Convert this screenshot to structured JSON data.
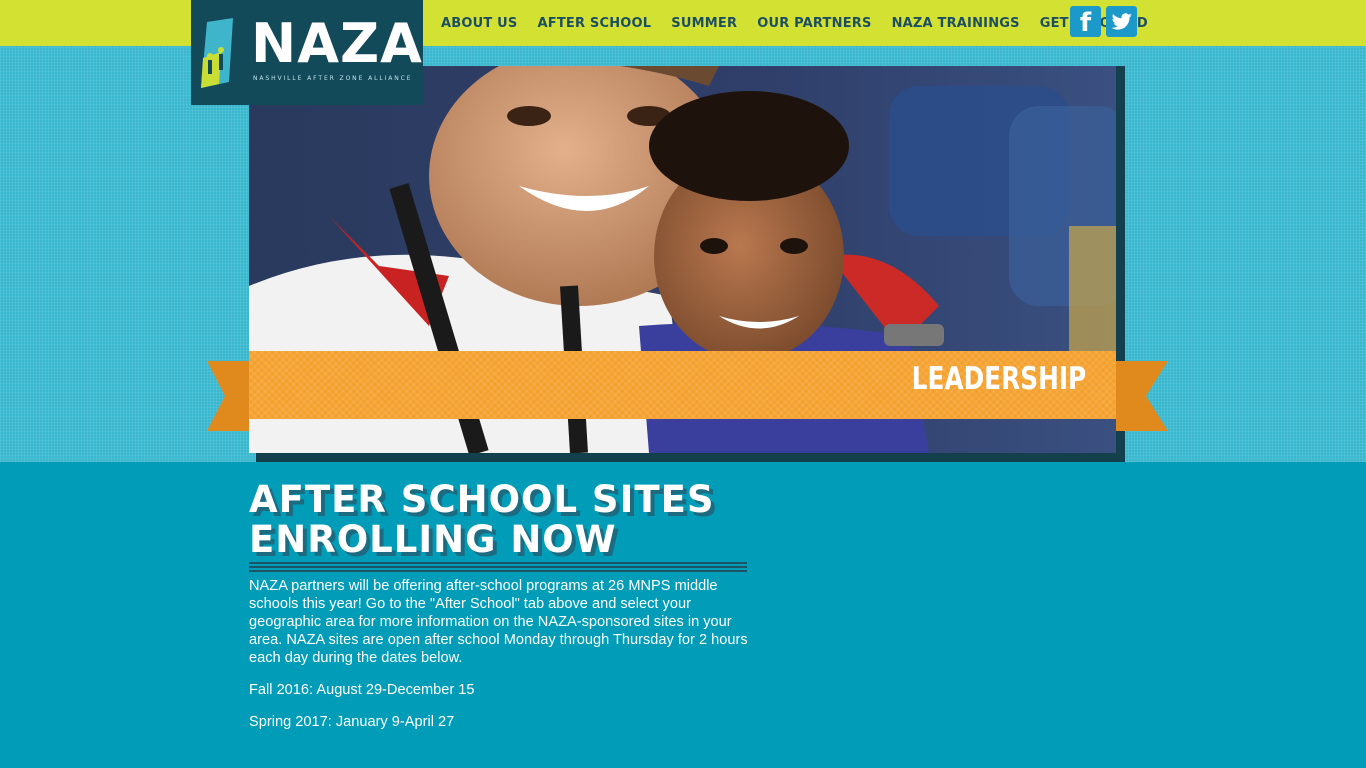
{
  "site": {
    "logo_text": "NAZA",
    "logo_tagline": "NASHVILLE AFTER ZONE ALLIANCE"
  },
  "nav": {
    "items": [
      {
        "label": "ABOUT US"
      },
      {
        "label": "AFTER SCHOOL"
      },
      {
        "label": "SUMMER"
      },
      {
        "label": "OUR PARTNERS"
      },
      {
        "label": "NAZA TRAININGS"
      },
      {
        "label": "GET INVOLVED"
      }
    ]
  },
  "social": {
    "facebook_icon": "facebook-icon",
    "twitter_icon": "twitter-icon"
  },
  "hero": {
    "banner_label": "LEADERSHIP",
    "photo_subject": "two smiling children photo"
  },
  "article": {
    "headline_line1": "AFTER SCHOOL SITES",
    "headline_line2": "ENROLLING NOW",
    "paragraphs": [
      "NAZA partners will be offering after-school programs at 26 MNPS middle schools this year! Go to the \"After School\" tab above and select your geographic area for more information on the NAZA-sponsored sites in your area. NAZA sites are open after school Monday through Thursday for 2 hours each day during the dates below.",
      "Fall 2016: August 29-December 15",
      "Spring 2017: January 9-April 27"
    ]
  },
  "colors": {
    "topbar": "#d3e132",
    "hero_background": "#3ab8cf",
    "page_background": "#009cb8",
    "logo_background": "#134a5a",
    "ribbon": "#f4a02c",
    "nav_text": "#1d4f63",
    "social_button": "#1b9ac9"
  }
}
